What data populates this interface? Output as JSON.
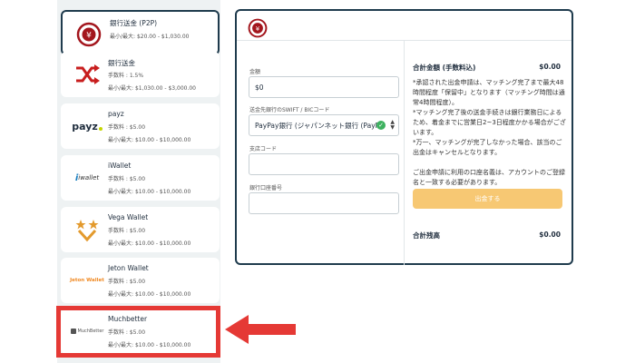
{
  "methods": [
    {
      "name": "銀行送金 (P2P)",
      "limit": "最小/最大: $20.00 - $1,030.00",
      "icon": "yen-coin-icon"
    },
    {
      "name": "銀行送金",
      "fee": "手数料 : 1.5%",
      "limit": "最小/最大: $1,030.00 - $3,000.00",
      "icon": "shuffle-icon"
    },
    {
      "name": "payz",
      "fee": "手数料 : $5.00",
      "limit": "最小/最大: $10.00 - $10,000.00",
      "logo_text": "payz",
      "icon": "payz-logo"
    },
    {
      "name": "iWallet",
      "fee": "手数料 : $5.00",
      "limit": "最小/最大: $10.00 - $10,000.00",
      "logo_text": "iwallet",
      "icon": "iwallet-logo"
    },
    {
      "name": "Vega Wallet",
      "fee": "手数料 : $5.00",
      "limit": "最小/最大: $10.00 - $10,000.00",
      "icon": "vega-stars-icon"
    },
    {
      "name": "Jeton Wallet",
      "fee": "手数料 : $5.00",
      "limit": "最小/最大: $10.00 - $10,000.00",
      "logo_text": "Jeton Wallet",
      "icon": "jeton-logo"
    },
    {
      "name": "Muchbetter",
      "fee": "手数料 : $5.00",
      "limit": "最小/最大: $10.00 - $10,000.00",
      "logo_text": "MuchBetter",
      "icon": "muchbetter-logo"
    }
  ],
  "form": {
    "amount_label": "金額",
    "amount_value": "$0",
    "swift_label": "送金先銀行のSWIFT / BICコード",
    "swift_value": "PayPay銀行 (ジャパンネット銀行 (PayPay",
    "branch_label": "支店コード",
    "branch_value": "",
    "account_label": "銀行口座番号",
    "account_value": ""
  },
  "summary": {
    "total_label": "合計金額 (手数料込)",
    "total_value": "$0.00",
    "notes": "*承認された出金申請は、マッチング完了まで最大48時間程度「保留中」となります（マッチング時間は通常4時間程度）。\n*マッチング完了後の送金手続きは銀行業務日によるため、着金までに営業日2~3日程度かかる場合がございます。\n*万一、マッチングが完了しなかった場合、該当のご出金はキャンセルとなります。\n\nご出金申請に利用の口座名義は、アカウントのご登録名と一致する必要があります。",
    "submit_label": "出金する",
    "balance_label": "合計残高",
    "balance_value": "$0.00"
  },
  "colors": {
    "accent": "#1f3b4d",
    "highlight": "#e53935",
    "submit": "#f7c873",
    "brand_red": "#a3161d"
  }
}
